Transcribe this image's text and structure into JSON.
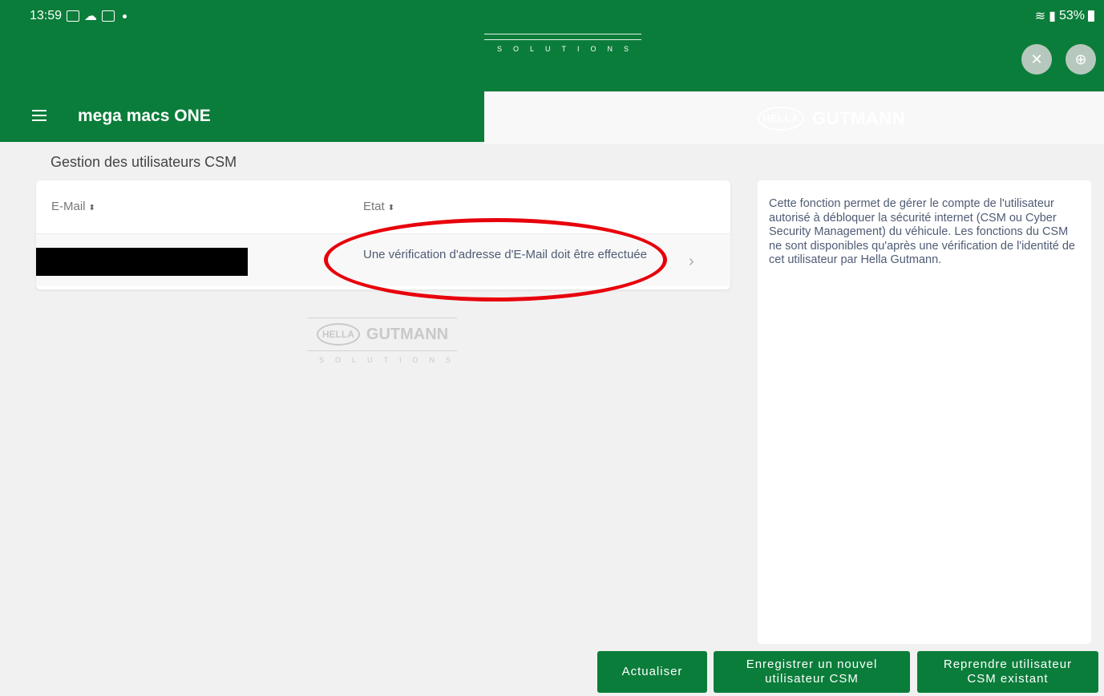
{
  "status_bar": {
    "time": "13:59",
    "battery": "53%"
  },
  "header": {
    "logo": {
      "brand": "GUTMANN",
      "badge": "HELLA",
      "subtitle": "SOLUTIONS"
    },
    "app_title": "mega macs ONE",
    "icons": [
      "bluetooth-off-icon",
      "globe-icon"
    ]
  },
  "page": {
    "title": "Gestion des utilisateurs CSM"
  },
  "table": {
    "columns": [
      {
        "label": "E-Mail"
      },
      {
        "label": "Etat"
      }
    ],
    "rows": [
      {
        "email": "",
        "state": "Une vérification d'adresse d'E-Mail doit être effectuée"
      }
    ]
  },
  "watermark": {
    "brand": "GUTMANN",
    "badge": "HELLA",
    "subtitle": "SOLUTIONS"
  },
  "info_panel": {
    "text": "Cette fonction permet de gérer le compte de l'utilisateur autorisé à débloquer la sécurité internet (CSM ou Cyber Security Management) du véhicule. Les fonctions du CSM ne sont disponibles qu'après une vérification de l'identité de cet utilisateur par Hella Gutmann."
  },
  "buttons": {
    "refresh": "Actualiser",
    "register": "Enregistrer un nouvel utilisateur CSM",
    "resume": "Reprendre utilisateur CSM existant"
  },
  "colors": {
    "brand_green": "#0b7d3a",
    "annotation_red": "#e8000b",
    "text_blue_gray": "#4f5b74"
  }
}
